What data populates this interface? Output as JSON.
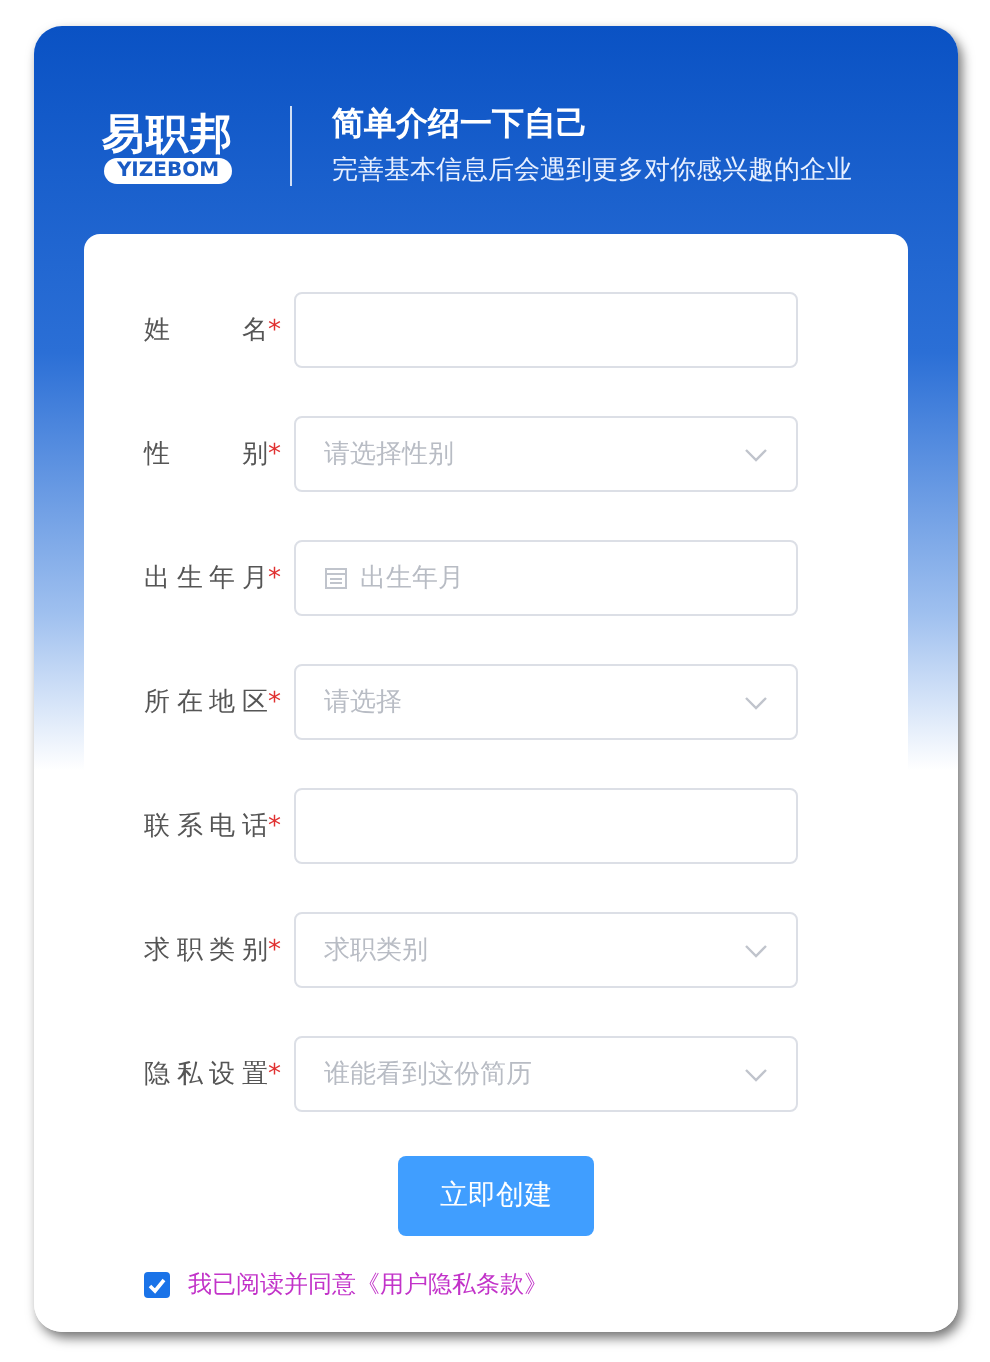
{
  "logo": {
    "name": "易职邦",
    "tag": "YIZEBOM"
  },
  "header": {
    "title": "简单介绍一下自己",
    "subtitle": "完善基本信息后会遇到更多对你感兴趣的企业"
  },
  "fields": [
    {
      "label": "姓名",
      "required_mark": "*",
      "kind": "text"
    },
    {
      "label": "性别",
      "required_mark": "*",
      "kind": "select",
      "placeholder": "请选择性别"
    },
    {
      "label": "出生年月",
      "required_mark": "*",
      "kind": "date",
      "placeholder": "出生年月"
    },
    {
      "label": "所在地区",
      "required_mark": "*",
      "kind": "select",
      "placeholder": "请选择"
    },
    {
      "label": "联系电话",
      "required_mark": "*",
      "kind": "text"
    },
    {
      "label": "求职类别",
      "required_mark": "*",
      "kind": "select",
      "placeholder": "求职类别"
    },
    {
      "label": "隐私设置",
      "required_mark": "*",
      "kind": "select",
      "placeholder": "谁能看到这份简历"
    }
  ],
  "submit": "立即创建",
  "agreement": {
    "checked": true,
    "text": "我已阅读并同意《用户隐私条款》"
  }
}
